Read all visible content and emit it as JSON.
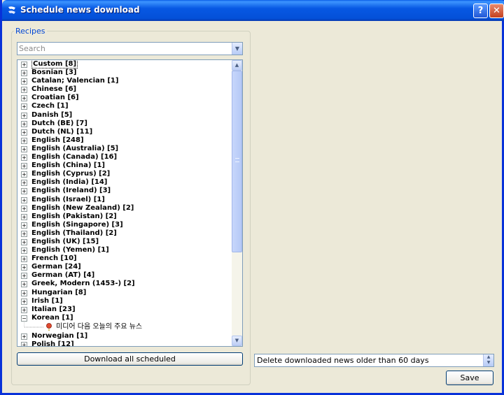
{
  "window": {
    "title": "Schedule news download",
    "help_label": "?",
    "close_label": "✕"
  },
  "recipes": {
    "group_label": "Recipes",
    "search": {
      "placeholder": "Search",
      "value": ""
    },
    "items": [
      {
        "label": "Custom [8]",
        "expanded": false
      },
      {
        "label": "Bosnian [3]",
        "expanded": false
      },
      {
        "label": "Catalan; Valencian [1]",
        "expanded": false
      },
      {
        "label": "Chinese [6]",
        "expanded": false
      },
      {
        "label": "Croatian [6]",
        "expanded": false
      },
      {
        "label": "Czech [1]",
        "expanded": false
      },
      {
        "label": "Danish [5]",
        "expanded": false
      },
      {
        "label": "Dutch (BE) [7]",
        "expanded": false
      },
      {
        "label": "Dutch (NL) [11]",
        "expanded": false
      },
      {
        "label": "English [248]",
        "expanded": false
      },
      {
        "label": "English (Australia) [5]",
        "expanded": false
      },
      {
        "label": "English (Canada) [16]",
        "expanded": false
      },
      {
        "label": "English (China) [1]",
        "expanded": false
      },
      {
        "label": "English (Cyprus) [2]",
        "expanded": false
      },
      {
        "label": "English (India) [14]",
        "expanded": false
      },
      {
        "label": "English (Ireland) [3]",
        "expanded": false
      },
      {
        "label": "English (Israel) [1]",
        "expanded": false
      },
      {
        "label": "English (New Zealand) [2]",
        "expanded": false
      },
      {
        "label": "English (Pakistan) [2]",
        "expanded": false
      },
      {
        "label": "English (Singapore) [3]",
        "expanded": false
      },
      {
        "label": "English (Thailand) [2]",
        "expanded": false
      },
      {
        "label": "English (UK) [15]",
        "expanded": false
      },
      {
        "label": "English (Yemen) [1]",
        "expanded": false
      },
      {
        "label": "French [10]",
        "expanded": false
      },
      {
        "label": "German [24]",
        "expanded": false
      },
      {
        "label": "German (AT) [4]",
        "expanded": false
      },
      {
        "label": "Greek, Modern (1453-) [2]",
        "expanded": false
      },
      {
        "label": "Hungarian [8]",
        "expanded": false
      },
      {
        "label": "Irish [1]",
        "expanded": false
      },
      {
        "label": "Italian [23]",
        "expanded": false
      },
      {
        "label": "Korean [1]",
        "expanded": true,
        "children": [
          "미디어 다음 오늘의 주요 뉴스"
        ]
      },
      {
        "label": "Norwegian [1]",
        "expanded": false
      },
      {
        "label": "Polish [12]",
        "expanded": false
      }
    ],
    "download_all_label": "Download all scheduled"
  },
  "settings": {
    "delete_option": "Delete downloaded news older than 60 days",
    "save_label": "Save"
  },
  "icons": {
    "app": "calibre-icon",
    "expand": "plus-box-icon",
    "collapse": "minus-box-icon",
    "recipe": "news-pin-icon"
  }
}
